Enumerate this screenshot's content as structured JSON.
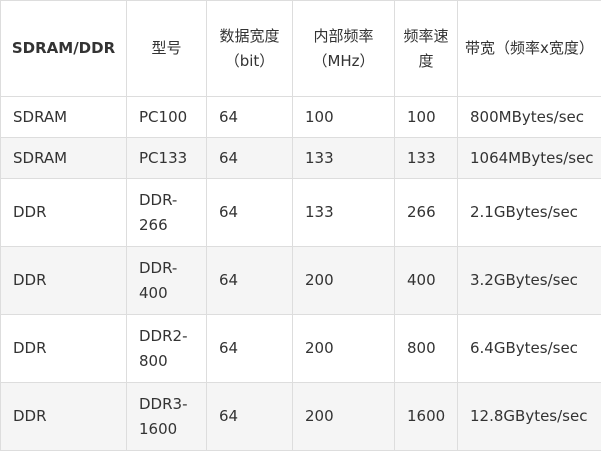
{
  "table": {
    "headers": [
      "SDRAM/DDR",
      "型号",
      "数据宽度（bit）",
      "内部频率（MHz）",
      "频率速度",
      "带宽（频率x宽度）"
    ],
    "rows": [
      [
        "SDRAM",
        "PC100",
        "64",
        "100",
        "100",
        "800MBytes/sec"
      ],
      [
        "SDRAM",
        "PC133",
        "64",
        "133",
        "133",
        "1064MBytes/sec"
      ],
      [
        "DDR",
        "DDR-266",
        "64",
        "133",
        "266",
        "2.1GBytes/sec"
      ],
      [
        "DDR",
        "DDR-400",
        "64",
        "200",
        "400",
        "3.2GBytes/sec"
      ],
      [
        "DDR",
        "DDR2-800",
        "64",
        "200",
        "800",
        "6.4GBytes/sec"
      ],
      [
        "DDR",
        "DDR3-1600",
        "64",
        "200",
        "1600",
        "12.8GBytes/sec"
      ]
    ]
  }
}
